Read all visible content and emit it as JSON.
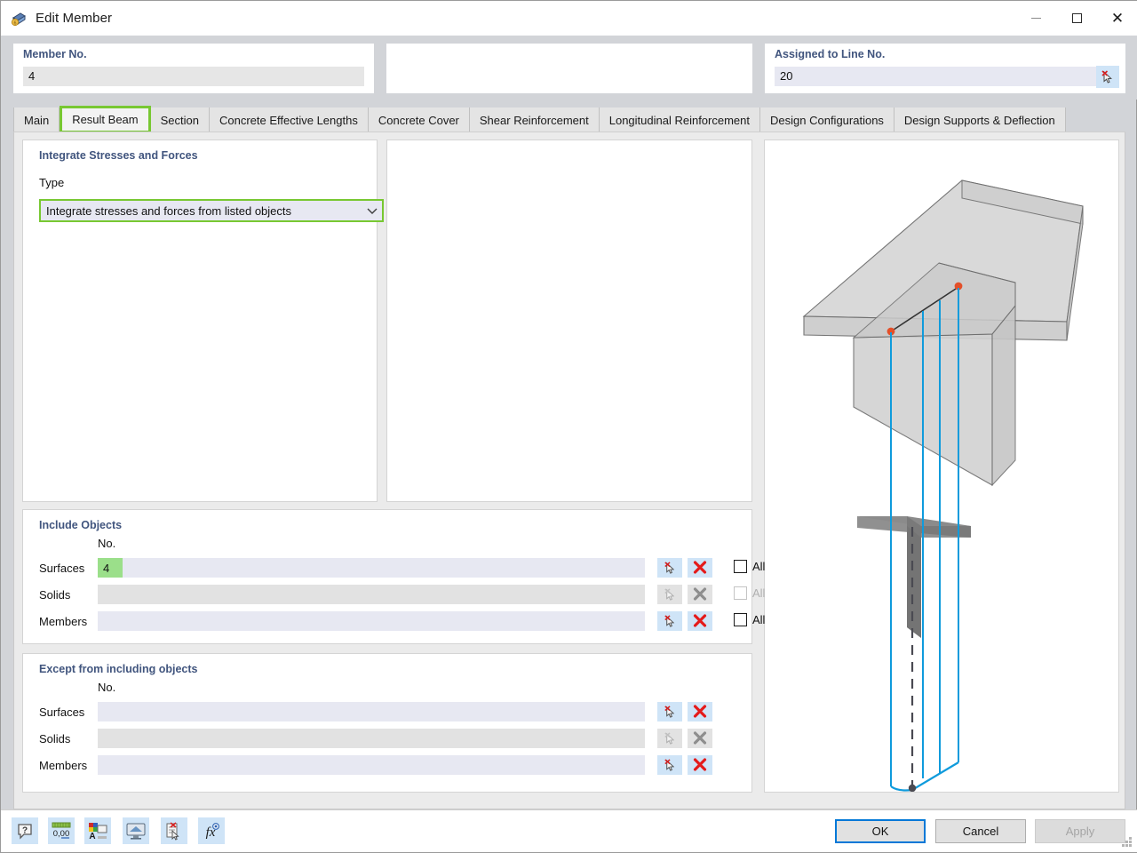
{
  "window": {
    "title": "Edit Member",
    "icon": "member-icon",
    "controls": {
      "minimize": "minimize-icon",
      "maximize": "maximize-icon",
      "close": "close-icon"
    }
  },
  "header": {
    "member": {
      "label": "Member No.",
      "value": "4"
    },
    "middle": {
      "label": "",
      "value": ""
    },
    "line": {
      "label": "Assigned to Line No.",
      "value": "20",
      "pick_icon": "select-pick-icon"
    }
  },
  "tabs": [
    {
      "label": "Main",
      "active": false
    },
    {
      "label": "Result Beam",
      "active": true
    },
    {
      "label": "Section",
      "active": false
    },
    {
      "label": "Concrete Effective Lengths",
      "active": false
    },
    {
      "label": "Concrete Cover",
      "active": false
    },
    {
      "label": "Shear Reinforcement",
      "active": false
    },
    {
      "label": "Longitudinal Reinforcement",
      "active": false
    },
    {
      "label": "Design Configurations",
      "active": false
    },
    {
      "label": "Design Supports & Deflection",
      "active": false
    }
  ],
  "integrate": {
    "title": "Integrate Stresses and Forces",
    "type_label": "Type",
    "type_value": "Integrate stresses and forces from listed objects",
    "arrow_icon": "chevron-down-icon"
  },
  "include_objects": {
    "title": "Include Objects",
    "col_no": "No.",
    "all_label": "All",
    "rows": [
      {
        "label": "Surfaces",
        "value": "4",
        "selected": true,
        "disabled": false,
        "has_all": true,
        "all_checked": false
      },
      {
        "label": "Solids",
        "value": "",
        "selected": false,
        "disabled": true,
        "has_all": true,
        "all_checked": false
      },
      {
        "label": "Members",
        "value": "",
        "selected": false,
        "disabled": false,
        "has_all": true,
        "all_checked": false
      }
    ],
    "pick_icon": "select-pick-icon",
    "clear_icon": "delete-x-icon"
  },
  "except_objects": {
    "title": "Except from including objects",
    "col_no": "No.",
    "rows": [
      {
        "label": "Surfaces",
        "value": "",
        "disabled": false
      },
      {
        "label": "Solids",
        "value": "",
        "disabled": true
      },
      {
        "label": "Members",
        "value": "",
        "disabled": false
      }
    ],
    "pick_icon": "select-pick-icon",
    "clear_icon": "delete-x-icon"
  },
  "preview": {
    "label": "",
    "badge_icon": "image-copy-icon",
    "shapes": "t-beam-result-beam-3d"
  },
  "toolbar": [
    {
      "name": "help-icon",
      "label": "?"
    },
    {
      "name": "number-format-icon",
      "label": "0,00"
    },
    {
      "name": "text-color-icon",
      "label": "A"
    },
    {
      "name": "display-properties-icon",
      "label": ""
    },
    {
      "name": "delete-document-icon",
      "label": ""
    },
    {
      "name": "formula-fx-icon",
      "label": "fx"
    }
  ],
  "buttons": {
    "ok": "OK",
    "cancel": "Cancel",
    "apply": "Apply"
  },
  "colors": {
    "accent_green": "#78c832",
    "select_green": "#9bdf8a",
    "header_blue": "#41557e",
    "field_lavender": "#e7e8f2",
    "icon_blue_bg": "#cfe4f7",
    "focus_blue": "#0078d7",
    "preview_blue": "#0f9bdc",
    "node_red": "#e3502a"
  }
}
